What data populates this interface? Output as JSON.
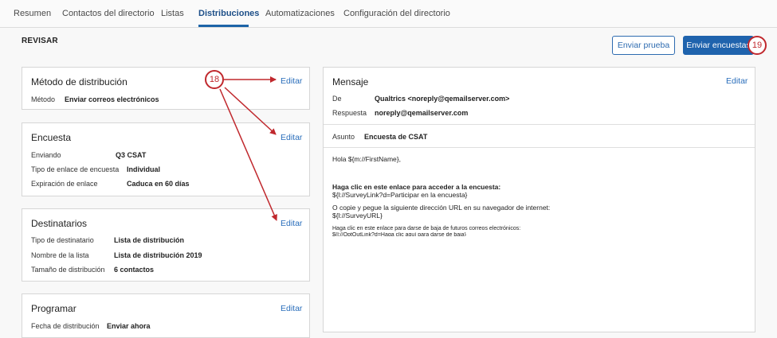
{
  "tabs": [
    {
      "label": "Resumen"
    },
    {
      "label": "Contactos del directorio"
    },
    {
      "label": "Listas"
    },
    {
      "label": "Distribuciones"
    },
    {
      "label": "Automatizaciones"
    },
    {
      "label": "Configuración del directorio"
    }
  ],
  "active_tab": "Distribuciones",
  "header": {
    "title": "REVISAR",
    "test_button": "Enviar prueba",
    "send_button": "Enviar encuestas"
  },
  "distribution_method": {
    "title": "Método de distribución",
    "edit": "Editar",
    "method_label": "Método",
    "method_value": "Enviar correos electrónicos"
  },
  "survey": {
    "title": "Encuesta",
    "edit": "Editar",
    "rows": [
      {
        "label": "Enviando",
        "value": "Q3 CSAT"
      },
      {
        "label": "Tipo de enlace de encuesta",
        "value": "Individual"
      },
      {
        "label": "Expiración de enlace",
        "value": "Caduca en 60 días"
      }
    ]
  },
  "recipients": {
    "title": "Destinatarios",
    "edit": "Editar",
    "rows": [
      {
        "label": "Tipo de destinatario",
        "value": "Lista de distribución"
      },
      {
        "label": "Nombre de la lista",
        "value": "Lista de distribución 2019"
      },
      {
        "label": "Tamaño de distribución",
        "value": "6 contactos"
      }
    ]
  },
  "schedule": {
    "title": "Programar",
    "edit": "Editar",
    "date_label": "Fecha de distribución",
    "date_value": "Enviar ahora"
  },
  "message": {
    "title": "Mensaje",
    "edit": "Editar",
    "from_label": "De",
    "from_value": "Qualtrics <noreply@qemailserver.com>",
    "reply_label": "Respuesta",
    "reply_value": "noreply@qemailserver.com",
    "subject_label": "Asunto",
    "subject_value": "Encuesta de CSAT",
    "body": {
      "greeting": "Hola ${m://FirstName},",
      "link_heading": "Haga clic en este enlace para acceder a la encuesta:",
      "link_code": "${l://SurveyLink?d=Participar en la encuesta}",
      "copy_text": "O copie y pegue la siguiente dirección URL en su navegador de internet:",
      "url_code": "${l://SurveyURL}",
      "optout_text": "Haga clic en este enlace para darse de baja de futuros correos electrónicos:",
      "optout_code": "${l://OptOutLink?d=Haga clic aquí para darse de baja}"
    }
  },
  "annotations": {
    "callout_18": "18",
    "callout_19": "19",
    "annotation_color": "#c0282d"
  },
  "colors": {
    "accent": "#1f63ad",
    "link": "#2a6ebb"
  }
}
